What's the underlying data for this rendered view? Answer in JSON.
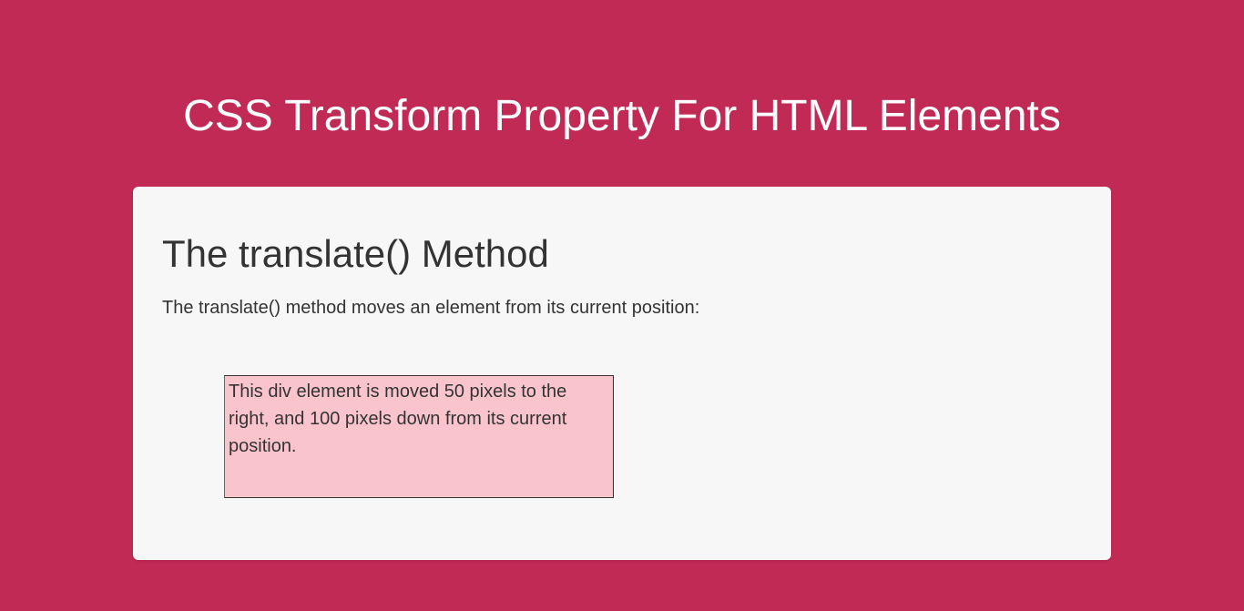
{
  "page": {
    "title": "CSS Transform Property For HTML Elements"
  },
  "content": {
    "heading": "The translate() Method",
    "description": "The translate() method moves an element from its current position:",
    "demo_text": "This div element is moved 50 pixels to the right, and 100 pixels down from its current position."
  }
}
